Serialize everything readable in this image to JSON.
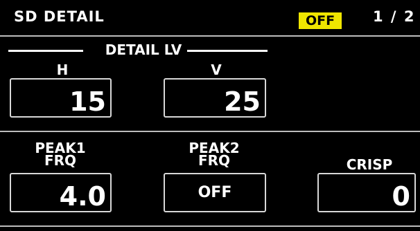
{
  "header": {
    "title": "SD DETAIL",
    "status": "OFF",
    "page": "1 / 2",
    "status_color": "#f0e600"
  },
  "detail_lv": {
    "title": "DETAIL LV",
    "h": {
      "label": "H",
      "value": "15"
    },
    "v": {
      "label": "V",
      "value": "25"
    }
  },
  "params": {
    "peak1": {
      "label": "PEAK1\nFRQ",
      "value": "4.0"
    },
    "peak2": {
      "label": "PEAK2\nFRQ",
      "value": "OFF"
    },
    "crisp": {
      "label": "CRISP",
      "value": "0"
    }
  }
}
